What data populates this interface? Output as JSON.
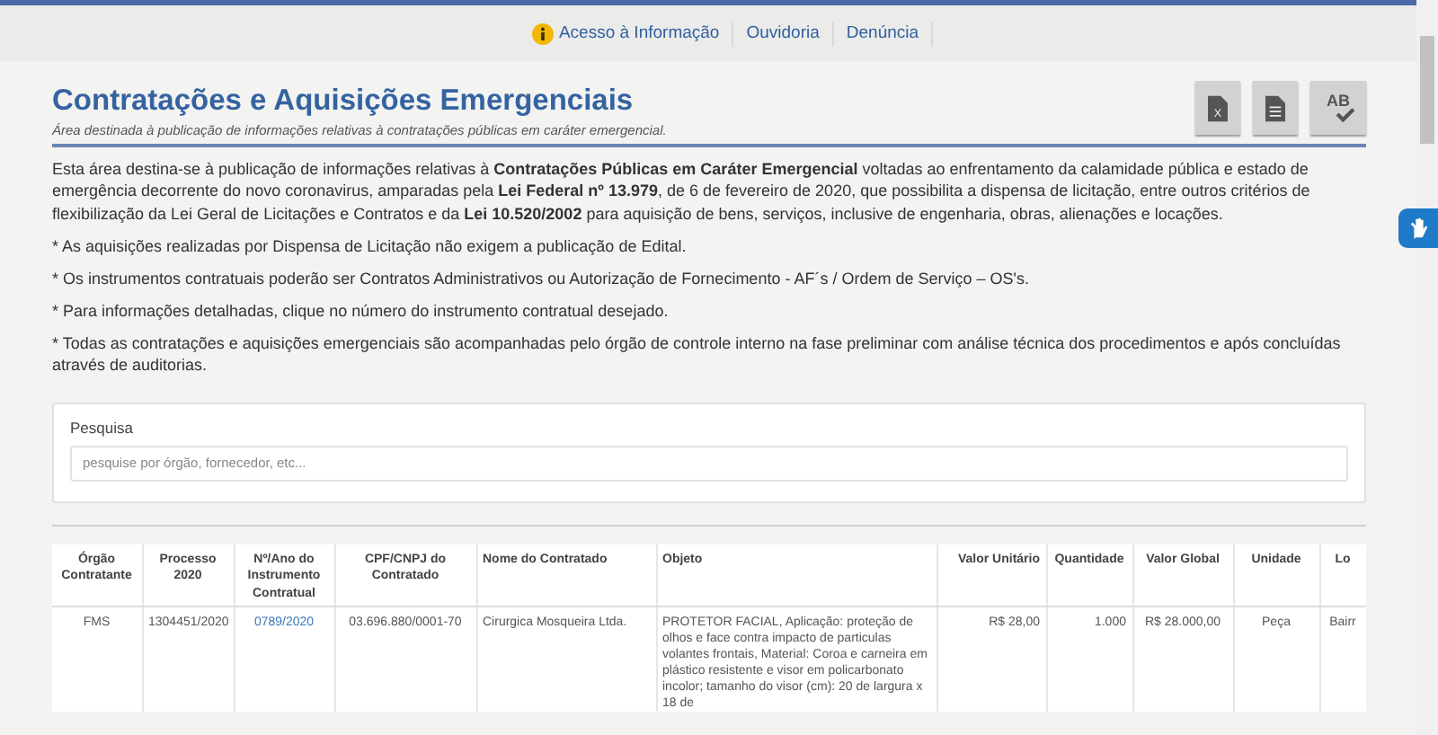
{
  "top_nav": [
    {
      "label": "Acesso à Informação",
      "kind": "info"
    },
    {
      "label": "Ouvidoria",
      "kind": "link"
    },
    {
      "label": "Denúncia",
      "kind": "link"
    }
  ],
  "header": {
    "title": "Contratações e Aquisições Emergenciais",
    "subtitle": "Área destinada à publicação de informações relativas à contratações públicas em caráter emergencial.",
    "tools": [
      {
        "kind": "excel",
        "label": "X"
      },
      {
        "kind": "document"
      },
      {
        "kind": "spellcheck",
        "label": "AB"
      }
    ]
  },
  "intro": "Esta área destina-se à publicação de informações relativas à **Contratações Públicas em Caráter Emergencial** voltadas ao enfrentamento da calamidade pública e estado de emergência decorrente do novo coronavirus, amparadas pela **Lei Federal nº 13.979**, de 6 de fevereiro de 2020, que possibilita a dispensa de licitação, entre outros critérios de flexibilização da Lei Geral de Licitações e Contratos e da **Lei 10.520/2002** para aquisição de bens, serviços, inclusive de engenharia, obras, alienações e locações.",
  "notes": [
    "* As aquisições realizadas por Dispensa de Licitação não exigem a publicação de Edital.",
    "* Os instrumentos contratuais poderão ser Contratos Administrativos ou Autorização de Fornecimento - AF´s / Ordem de Serviço – OS's.",
    "* Para informações detalhadas, clique no número do instrumento contratual desejado.",
    "* Todas as contratações e aquisições emergenciais são acompanhadas pelo órgão de controle interno na fase preliminar com análise técnica dos procedimentos e após concluídas através de auditorias."
  ],
  "search": {
    "label": "Pesquisa",
    "placeholder": "pesquise por órgão, fornecedor, etc..."
  },
  "table": {
    "columns": [
      {
        "label": "Órgão Contratante",
        "kind": "text"
      },
      {
        "label": "Processo 2020",
        "kind": "text"
      },
      {
        "label": "Nº/Ano do Instrumento Contratual",
        "kind": "link"
      },
      {
        "label": "CPF/CNPJ do Contratado",
        "kind": "text"
      },
      {
        "label": "Nome do Contratado",
        "kind": "text"
      },
      {
        "label": "Objeto",
        "kind": "text"
      },
      {
        "label": "Valor Unitário",
        "kind": "text"
      },
      {
        "label": "Quantidade",
        "kind": "text"
      },
      {
        "label": "Valor Global",
        "kind": "text"
      },
      {
        "label": "Unidade",
        "kind": "text"
      },
      {
        "label": "Lo",
        "kind": "text"
      }
    ],
    "rows": [
      {
        "cells": [
          "FMS",
          "1304451/2020",
          "0789/2020",
          "03.696.880/0001-70",
          "Cirurgica Mosqueira Ltda.",
          "PROTETOR FACIAL, Aplicação: proteção de olhos e face contra impacto de particulas volantes frontais, Material: Coroa e carneira em plástico resistente e visor em policarbonato incolor; tamanho do visor (cm): 20 de largura x 18 de",
          "R$ 28,00",
          "1.000",
          "R$ 28.000,00",
          "Peça",
          "Bairr"
        ]
      }
    ]
  }
}
